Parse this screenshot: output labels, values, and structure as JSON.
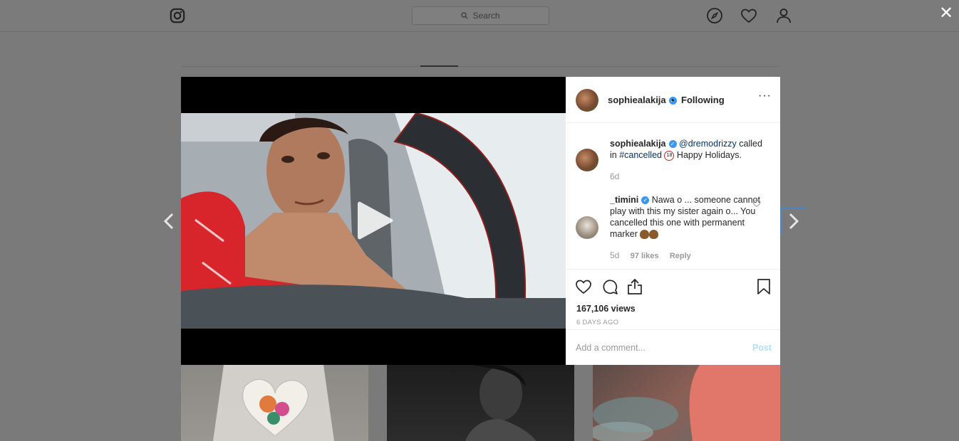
{
  "topbar": {
    "search_placeholder": "Search",
    "icons": [
      "instagram-logo-icon",
      "compass-icon",
      "heart-icon",
      "profile-icon"
    ]
  },
  "close_icon": "✕",
  "post": {
    "header": {
      "username": "sophiealakija",
      "verified": true,
      "separator": "•",
      "following": "Following",
      "more": "···"
    },
    "caption": {
      "username": "sophiealakija",
      "mention": "@dremodrizzy",
      "text_1": " called in ",
      "hashtag": "#cancelled",
      "text_2": " Happy Holidays.",
      "age": "6d"
    },
    "comments": [
      {
        "username": "_timini",
        "verified": true,
        "text": "Nawa o ... someone cannot play with this my sister again o... You cancelled this one with permanent marker",
        "age": "5d",
        "likes": "97 likes",
        "reply": "Reply"
      }
    ],
    "views": "167,106 views",
    "posted": "6 DAYS AGO",
    "add_comment_placeholder": "Add a comment...",
    "post_label": "Post"
  },
  "colors": {
    "accent": "#3897f0",
    "link": "#003569",
    "post_disabled": "#b2dffc"
  }
}
